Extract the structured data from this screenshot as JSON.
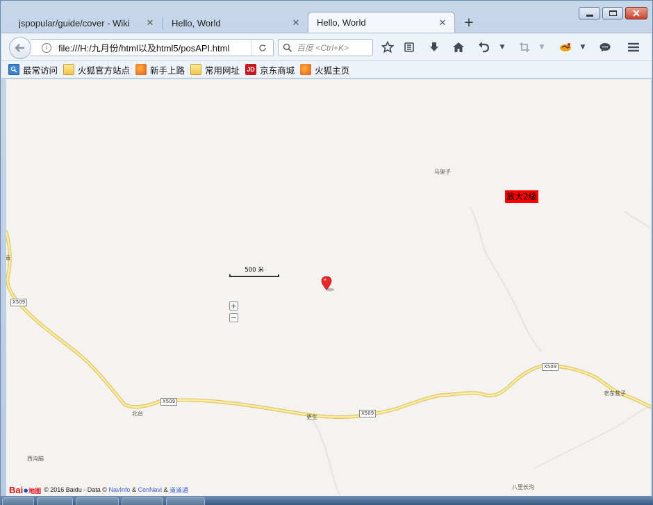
{
  "browser": {
    "tabs": [
      {
        "label": "jspopular/guide/cover - Wiki",
        "active": false
      },
      {
        "label": "Hello, World",
        "active": false
      },
      {
        "label": "Hello, World",
        "active": true
      }
    ],
    "tab_close_glyph": "✕",
    "new_tab_glyph": "+",
    "url": "file:///H:/九月份/html以及html5/posAPI.html",
    "search_placeholder": "百度 <Ctrl+K>",
    "toolbar_icons": [
      "bookmark-star-icon",
      "reading-list-icon",
      "download-icon",
      "home-icon",
      "undo-icon",
      "screenshot-icon",
      "addon-icon",
      "chat-icon",
      "menu-icon"
    ]
  },
  "bookmarks": [
    {
      "label": "最常访问",
      "icon": "most-visited-icon"
    },
    {
      "label": "火狐官方站点",
      "icon": "folder-icon"
    },
    {
      "label": "新手上路",
      "icon": "firefox-icon"
    },
    {
      "label": "常用网址",
      "icon": "folder-icon"
    },
    {
      "label": "京东商城",
      "icon": "jd-icon"
    },
    {
      "label": "火狐主页",
      "icon": "firefox-icon"
    }
  ],
  "map": {
    "zoom_badge": "放大2级",
    "scale_label": "500 米",
    "zoom_in": "+",
    "zoom_out": "−",
    "place_labels": {
      "majiazi": "马架子",
      "beitai": "北台",
      "gengsheng": "更生",
      "xigounao": "西沟脑",
      "laodongyingzi": "老东营子",
      "balichanggou": "八里长沟",
      "left_edge": "碳"
    },
    "road_tags": [
      "X509",
      "X509",
      "X509",
      "X509"
    ],
    "copyright": "© 2016 Baidu - Data ©",
    "copyright_link1": "NavInfo",
    "copyright_amp1": "&",
    "copyright_link2": "CenNavi",
    "copyright_amp2": "&",
    "copyright_link3": "道道通",
    "logo_text": "Bai",
    "logo_suffix": "地图"
  },
  "colors": {
    "map_bg": "#f4f3f0",
    "road_fill": "#fbeea0",
    "road_edge": "#e2c56a",
    "marker": "#e8272a",
    "badge": "#ff0000"
  }
}
